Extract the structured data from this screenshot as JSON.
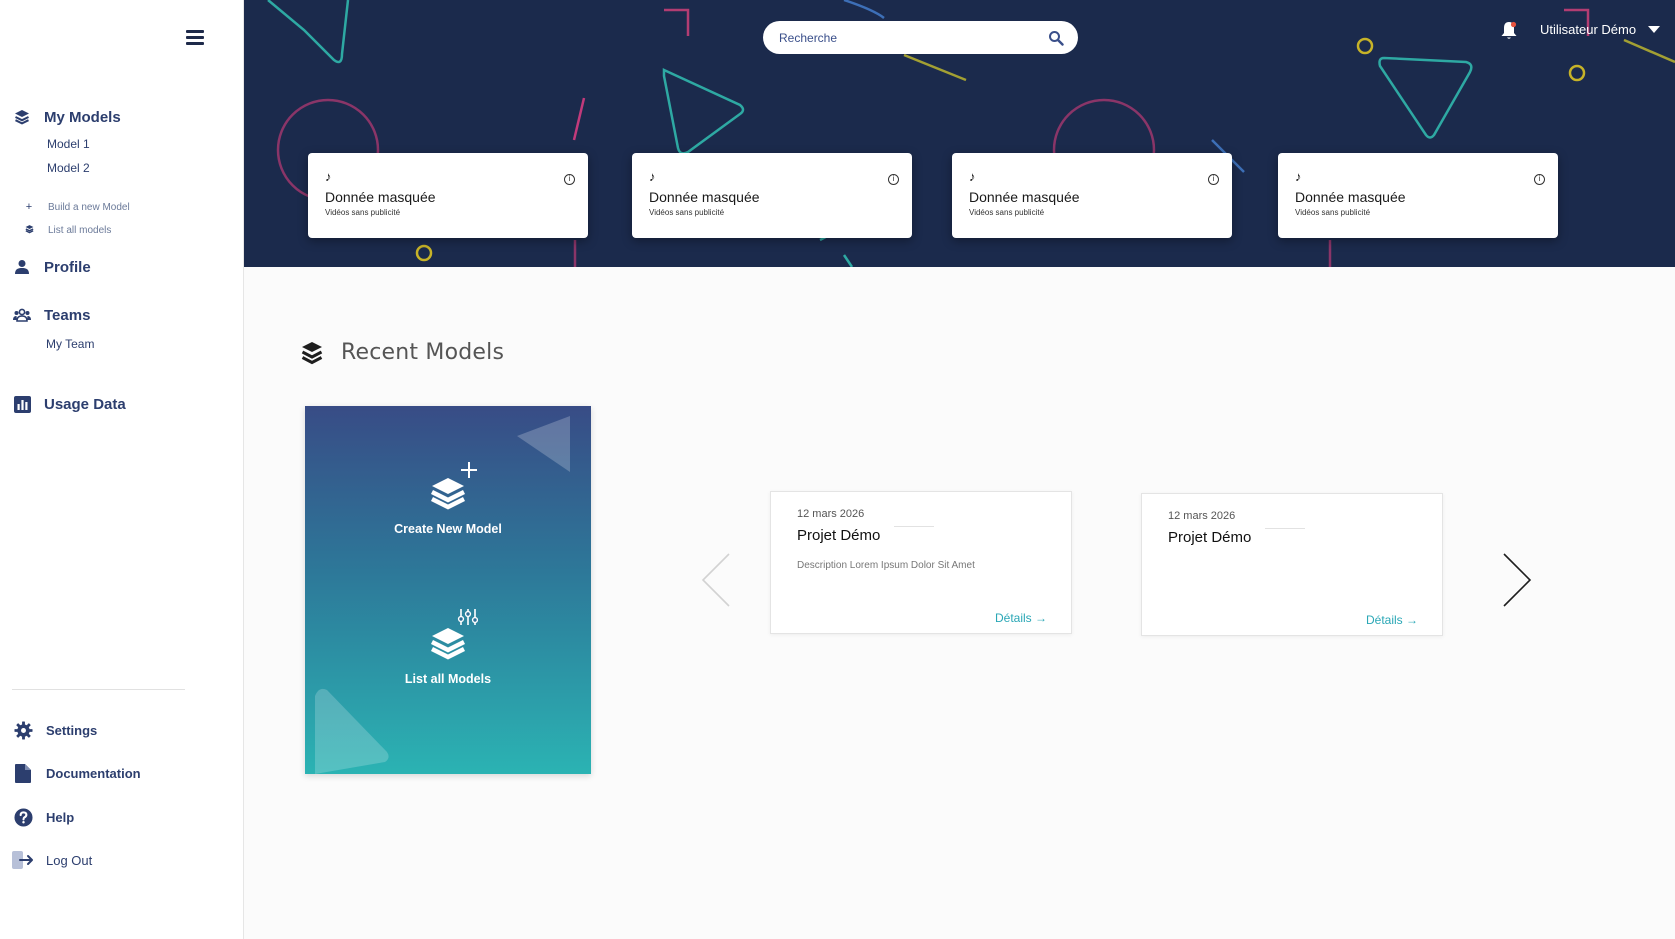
{
  "sidebar": {
    "menu_icon": "hamburger-icon",
    "my_models": {
      "label": "My Models",
      "icon": "layers-icon",
      "items": [
        "Model 1",
        "Model 2"
      ],
      "actions": [
        {
          "label": "Build a new Model",
          "icon": "plus-icon"
        },
        {
          "label": "List all models",
          "icon": "layers-icon"
        }
      ]
    },
    "profile": {
      "label": "Profile",
      "icon": "user-icon"
    },
    "teams": {
      "label": "Teams",
      "icon": "team-icon",
      "items": [
        "My Team"
      ]
    },
    "usage": {
      "label": "Usage Data",
      "icon": "chart-icon"
    },
    "bottom": {
      "settings": "Settings",
      "documentation": "Documentation",
      "help": "Help",
      "logout": "Log Out"
    }
  },
  "header": {
    "search_placeholder": "Recherche",
    "user_name": "Utilisateur Démo",
    "notification_icon": "bell-icon"
  },
  "stats": [
    {
      "title": "Donnée masquée",
      "subtitle": "Vidéos sans publicité",
      "icon": "music-note-icon"
    },
    {
      "title": "Donnée masquée",
      "subtitle": "Vidéos sans publicité",
      "icon": "music-note-icon"
    },
    {
      "title": "Donnée masquée",
      "subtitle": "Vidéos sans publicité",
      "icon": "music-note-icon"
    },
    {
      "title": "Donnée masquée",
      "subtitle": "Vidéos sans publicité",
      "icon": "music-note-icon"
    }
  ],
  "recent": {
    "title": "Recent Models",
    "create_label": "Create New Model",
    "list_label": "List all Models",
    "projects": [
      {
        "date": "12 mars 2026",
        "title": "Projet Démo",
        "description": "Description Lorem Ipsum Dolor Sit Amet",
        "details": "Détails →"
      },
      {
        "date": "12 mars 2026",
        "title": "Projet Démo",
        "description": "",
        "details": "Détails →"
      }
    ]
  },
  "colors": {
    "hero_bg": "#1b2a4c",
    "accent": "#2aa7b6",
    "nav_text": "#2c3e6e"
  }
}
